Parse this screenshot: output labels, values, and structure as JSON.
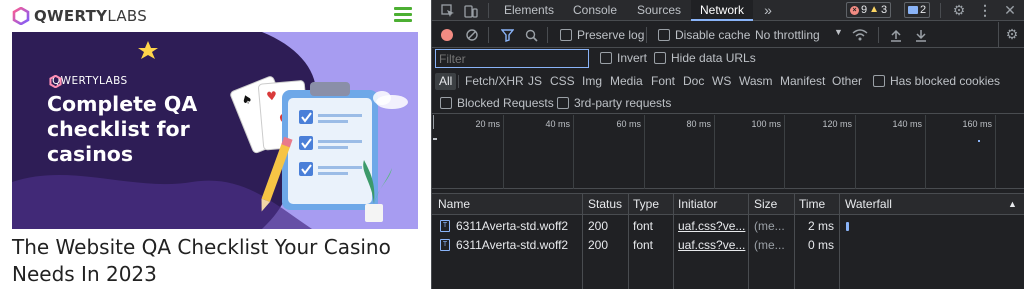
{
  "page": {
    "logo_text_bold": "QWERTY",
    "logo_text_light": "LABS",
    "hero": {
      "logo_text": "QWERTYLABS",
      "title": "Complete QA checklist for casinos"
    },
    "article_title": "The Website QA Checklist Your Casino Needs In 2023",
    "colors": {
      "menu": "#4caf32",
      "hero_bg": "#a79cf1",
      "hero_dark": "#2e1d56"
    }
  },
  "devtools": {
    "tabs": [
      "Elements",
      "Console",
      "Sources",
      "Network"
    ],
    "active_tab": "Network",
    "more_tabs": "»",
    "errors_count": "9",
    "warnings_count": "3",
    "messages_count": "2",
    "toolbar": {
      "preserve_log": "Preserve log",
      "disable_cache": "Disable cache",
      "throttling": "No throttling"
    },
    "filter": {
      "placeholder": "Filter",
      "invert": "Invert",
      "hide_data_urls": "Hide data URLs"
    },
    "types": [
      "All",
      "Fetch/XHR",
      "JS",
      "CSS",
      "Img",
      "Media",
      "Font",
      "Doc",
      "WS",
      "Wasm",
      "Manifest",
      "Other"
    ],
    "has_blocked_cookies": "Has blocked cookies",
    "blocked_requests": "Blocked Requests",
    "third_party": "3rd-party requests",
    "timeline_ticks": [
      "20 ms",
      "40 ms",
      "60 ms",
      "80 ms",
      "100 ms",
      "120 ms",
      "140 ms",
      "160 ms"
    ],
    "columns": [
      "Name",
      "Status",
      "Type",
      "Initiator",
      "Size",
      "Time",
      "Waterfall"
    ],
    "rows": [
      {
        "name": "6311Averta-std.woff2",
        "status": "200",
        "type": "font",
        "initiator": "uaf.css?ve...",
        "size": "(me...",
        "time": "2 ms"
      },
      {
        "name": "6311Averta-std.woff2",
        "status": "200",
        "type": "font",
        "initiator": "uaf.css?ve...",
        "size": "(me...",
        "time": "0 ms"
      }
    ]
  }
}
